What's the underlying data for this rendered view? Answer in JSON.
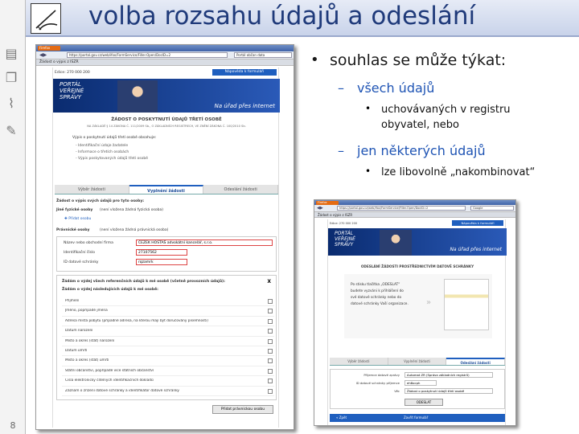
{
  "slide": {
    "title": "volba rozsahu údajů a odeslání",
    "page_number": "8"
  },
  "bullets": {
    "l1": "souhlas se může týkat:",
    "l2a": "všech údajů",
    "l3a_line1": "uchovávaných v registru",
    "l3a_line2": "obyvatel, nebo",
    "l2b": "jen některých údajů",
    "l3b": "lze libovolně „nakombinovat“"
  },
  "shot1": {
    "ff": "Firefox",
    "url": "https://portal.gov.cz/web/ifox/FormService/Filler.Open/DocID=2",
    "search": "Portál občan data",
    "tab": "Žádost o výpis z ISZR",
    "edition": "Edice: 270 000 200",
    "help_btn": "Nápověda k formuláři",
    "portal1": "PORTÁL",
    "portal2": "VEŘEJNÉ",
    "portal3": "SPRÁVY",
    "slogan": "Na úřad přes internet",
    "heading": "ŽÁDOST O POSKYTNUTÍ ÚDAJŮ TŘETÍ OSOBĚ",
    "sub1": "NA ZÁKLADĚ § 14 ZÁKONA Č. 111/2009 Sb., O ZÁKLADNÍCH REGISTRECH, VE ZNĚNÍ ZÁKONA Č. 100/2010 Sb.",
    "intro": "Výpis o poskytnutí údajů třetí osobě obsahuje:",
    "li1": "- Identifikační údaje žadatele",
    "li2": "- Informace o třetích osobách",
    "li3": "- Výpis poskytovaných údajů třetí osobě",
    "tab1": "Výběr žádosti",
    "tab2": "Vyplnění žádosti",
    "tab3": "Odeslání žádosti",
    "r1": "Žádost o výpis svých údajů pro tyto osoby:",
    "r2": "Jiné fyzické osoby",
    "r2b": "(není vložena žádná fyzická osoba)",
    "add_person": "Přidat osobu",
    "r3": "Právnické osoby",
    "r3b": "(není vložena žádná právnická osoba)",
    "f1": "Název nebo obchodní firma",
    "v1": "ČEZEK HOSTAŠ advokátní kancelář, s.r.o.",
    "f2": "Identifikační číslo",
    "v2": "27107562",
    "f3": "ID datové schránky",
    "v3": "rqzamrk",
    "s1": "Žádám o výdej všech referenčních údajů k mé osobě (včetně provozních údajů):",
    "s2": "Žádám o výdej následujících údajů k mé osobě:",
    "items": [
      "Příjmení",
      "Jméno, popřípadě jména",
      "Adresa místa pobytu (případně adresa, na kterou mají být doručovány písemnosti)",
      "Datum narození",
      "Místo a okres (stát) narození",
      "Datum úmrtí",
      "Místo a okres (stát) úmrtí",
      "Státní občanství, popřípadě více státních občanství",
      "Čísla elektronicky čitelných identifikačních dokladů",
      "Záznam o zřízení datové schránky a identifikátor datové schránky"
    ],
    "x": "X",
    "add_btn": "Přidat právnickou osobu"
  },
  "shot2": {
    "ff": "Firefox",
    "url": "https://portal.gov.cz/web/ifox/FormService/Filler.Open/DocID=2",
    "search": "Google",
    "tab": "Žádost o výpis z ISZR",
    "edition": "Edice: 270 000 200",
    "help_btn": "Nápověda k formuláři",
    "portal1": "PORTÁL",
    "portal2": "VEŘEJNÉ",
    "portal3": "SPRÁVY",
    "slogan": "Na úřad přes internet",
    "heading": "ODESLÁNÍ ŽÁDOSTI PROSTŘEDNICTVÍM DATOVÉ SCHRÁNKY",
    "p1": "Po stisku tlačítka „ODESLAT“",
    "p2": "budete vyzváni k přihlášení do",
    "p3": "své datové schránky nebo do",
    "p4": "datové schránky Vaší organizace.",
    "tab1": "Výběr žádosti",
    "tab2": "Vyplnění žádosti",
    "tab3": "Odeslání žádosti",
    "f1": "Příjemce datové zprávy",
    "v1": "Automat ZR (Správa základních registrů)",
    "f2": "ID datové schránky příjemce",
    "v2": "eh8ocph",
    "f3": "Věc",
    "v3": "Žádost o poskytnutí údajů třetí osobě",
    "send": "ODESLAT",
    "back": "« Zpět",
    "close": "Zavřít formulář"
  }
}
